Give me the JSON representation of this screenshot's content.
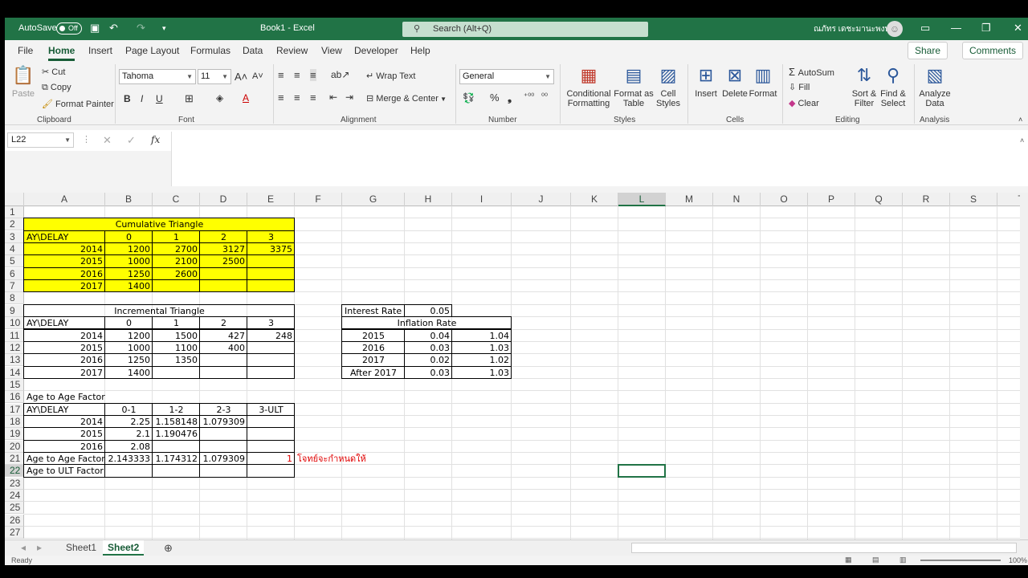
{
  "titlebar": {
    "autosave": "AutoSave",
    "toggle": "Off",
    "book": "Book1  -  Excel",
    "search": "Search (Alt+Q)",
    "user": "ณภัทร เดชะมานะพงษ์"
  },
  "tabs": [
    "File",
    "Home",
    "Insert",
    "Page Layout",
    "Formulas",
    "Data",
    "Review",
    "View",
    "Developer",
    "Help"
  ],
  "actions": {
    "share": "Share",
    "comments": "Comments"
  },
  "ribbon": {
    "clipboard": {
      "paste": "Paste",
      "cut": "Cut",
      "copy": "Copy",
      "painter": "Format Painter",
      "label": "Clipboard"
    },
    "font": {
      "name": "Tahoma",
      "size": "11",
      "label": "Font"
    },
    "alignment": {
      "wrap": "Wrap Text",
      "merge": "Merge & Center",
      "label": "Alignment"
    },
    "number": {
      "format": "General",
      "label": "Number"
    },
    "styles": {
      "cond": [
        "Conditional",
        "Formatting"
      ],
      "table": [
        "Format as",
        "Table"
      ],
      "cell": [
        "Cell",
        "Styles"
      ],
      "label": "Styles"
    },
    "cells": {
      "insert": "Insert",
      "delete": "Delete",
      "format": "Format",
      "label": "Cells"
    },
    "editing": {
      "autosum": "AutoSum",
      "fill": "Fill",
      "clear": "Clear",
      "sort": [
        "Sort &",
        "Filter"
      ],
      "find": [
        "Find &",
        "Select"
      ],
      "label": "Editing"
    },
    "analysis": {
      "analyze": [
        "Analyze",
        "Data"
      ],
      "label": "Analysis"
    }
  },
  "namebox": "L22",
  "columns": [
    "A",
    "B",
    "C",
    "D",
    "E",
    "F",
    "G",
    "H",
    "I",
    "J",
    "K",
    "L",
    "M",
    "N",
    "O",
    "P",
    "Q",
    "R",
    "S",
    "T"
  ],
  "rows": [
    "1",
    "2",
    "3",
    "4",
    "5",
    "6",
    "7",
    "8",
    "9",
    "10",
    "11",
    "12",
    "13",
    "14",
    "15",
    "16",
    "17",
    "18",
    "19",
    "20",
    "21",
    "22",
    "23",
    "24",
    "25",
    "26",
    "27"
  ],
  "cum": {
    "title": "Cumulative Triangle",
    "hdr": [
      "AY\\DELAY",
      "0",
      "1",
      "2",
      "3"
    ],
    "rows": [
      [
        "2014",
        "1200",
        "2700",
        "3127",
        "3375"
      ],
      [
        "2015",
        "1000",
        "2100",
        "2500",
        ""
      ],
      [
        "2016",
        "1250",
        "2600",
        "",
        ""
      ],
      [
        "2017",
        "1400",
        "",
        "",
        ""
      ]
    ]
  },
  "inc": {
    "title": "Incremental Triangle",
    "hdr": [
      "AY\\DELAY",
      "0",
      "1",
      "2",
      "3"
    ],
    "rows": [
      [
        "2014",
        "1200",
        "1500",
        "427",
        "248"
      ],
      [
        "2015",
        "1000",
        "1100",
        "400",
        ""
      ],
      [
        "2016",
        "1250",
        "1350",
        "",
        ""
      ],
      [
        "2017",
        "1400",
        "",
        "",
        ""
      ]
    ]
  },
  "ata": {
    "title": "Age to Age Factor",
    "hdr": [
      "AY\\DELAY",
      "0-1",
      "1-2",
      "2-3",
      "3-ULT"
    ],
    "rows": [
      [
        "2014",
        "2.25",
        "1.158148",
        "1.079309",
        ""
      ],
      [
        "2015",
        "2.1",
        "1.190476",
        "",
        ""
      ],
      [
        "2016",
        "2.08",
        "",
        "",
        ""
      ]
    ],
    "factor": [
      "Age to Age Factor",
      "2.143333",
      "1.174312",
      "1.079309",
      "1"
    ],
    "note": "โจทย์จะกำหนดให้",
    "ult": "Age to ULT Factor"
  },
  "rates": {
    "interest_label": "Interest Rate",
    "interest": "0.05",
    "inflation_title": "Inflation Rate",
    "rows": [
      [
        "2015",
        "0.04",
        "1.04"
      ],
      [
        "2016",
        "0.03",
        "1.03"
      ],
      [
        "2017",
        "0.02",
        "1.02"
      ],
      [
        "After 2017",
        "0.03",
        "1.03"
      ]
    ]
  },
  "sheets": [
    "Sheet1",
    "Sheet2"
  ],
  "status": {
    "ready": "Ready",
    "zoom": "100%"
  }
}
